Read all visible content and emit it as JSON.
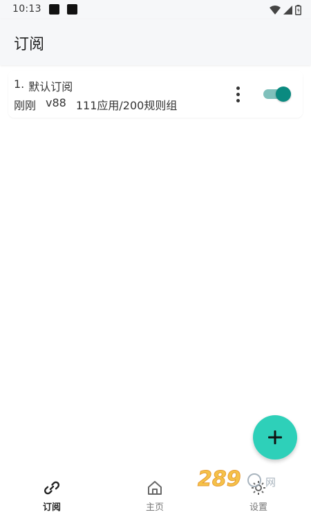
{
  "status_bar": {
    "time": "10:13"
  },
  "app_bar": {
    "title": "订阅"
  },
  "subscriptions": [
    {
      "index": "1.",
      "name": "默认订阅",
      "updated": "刚刚",
      "version": "v88",
      "stats": "111应用/200规则组",
      "enabled": true
    }
  ],
  "bottom_nav": {
    "subscribe_label": "订阅",
    "home_label": "主页",
    "settings_label": "设置",
    "active": "subscribe"
  },
  "watermark": {
    "text": "289 网"
  },
  "colors": {
    "accent": "#0a8a80",
    "track": "#7fc0bb",
    "fab": "#2ed0b9"
  }
}
